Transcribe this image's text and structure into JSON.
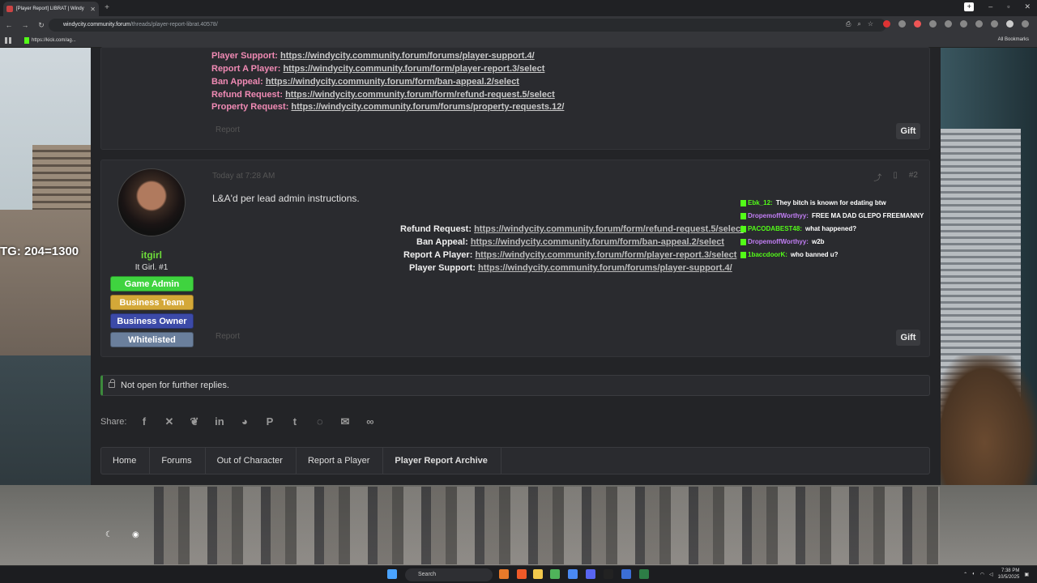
{
  "browser": {
    "tab_title": "[Player Report] LIBRAT | Windy",
    "url_domain": "windycity.community.forum",
    "url_path": "/threads/player-report-librat.40578/",
    "bookmark_kick": "https://kick.com/ag...",
    "all_bookmarks": "All Bookmarks"
  },
  "post1": {
    "links": [
      {
        "label": "Player Support:",
        "url": "https://windycity.community.forum/forums/player-support.4/"
      },
      {
        "label": "Report A Player:",
        "url": "https://windycity.community.forum/form/player-report.3/select"
      },
      {
        "label": "Ban Appeal:",
        "url": "https://windycity.community.forum/form/ban-appeal.2/select"
      },
      {
        "label": "Refund Request:",
        "url": "https://windycity.community.forum/form/refund-request.5/select"
      },
      {
        "label": "Property Request:",
        "url": "https://windycity.community.forum/forums/property-requests.12/"
      }
    ],
    "report": "Report",
    "gift": "Gift"
  },
  "post2": {
    "username": "itgirl",
    "user_title": "It Girl. #1",
    "banners": [
      "Game Admin",
      "Business Team",
      "Business Owner",
      "Whitelisted"
    ],
    "time": "Today at 7:28 AM",
    "post_number": "#2",
    "message": "L&A'd per lead admin instructions.",
    "links": [
      {
        "label": "Refund Request:",
        "url": "https://windycity.community.forum/form/refund-request.5/select"
      },
      {
        "label": "Ban Appeal:",
        "url": "https://windycity.community.forum/form/ban-appeal.2/select"
      },
      {
        "label": "Report A Player:",
        "url": "https://windycity.community.forum/form/player-report.3/select"
      },
      {
        "label": "Player Support:",
        "url": "https://windycity.community.forum/forums/player-support.4/"
      }
    ],
    "report": "Report",
    "gift": "Gift"
  },
  "chat": [
    {
      "user": "Ebk_12:",
      "color": "#53fc18",
      "msg": "They bitch is known for edating btw"
    },
    {
      "user": "DropemoffWorthyy:",
      "color": "#c27ef5",
      "msg": "FREE MA DAD GLEPO FREEMANNY"
    },
    {
      "user": "PACODABEST48:",
      "color": "#53fc18",
      "msg": "what happened?"
    },
    {
      "user": "DropemoffWorthyy:",
      "color": "#c27ef5",
      "msg": "w2b"
    },
    {
      "user": "1baccdoorK:",
      "color": "#53fc18",
      "msg": "who banned u?"
    }
  ],
  "overlay_counter": "TG: 204=1300",
  "locked_text": "Not open for further replies.",
  "share_label": "Share:",
  "share_icons": [
    "facebook-icon",
    "x-icon",
    "bluesky-icon",
    "linkedin-icon",
    "reddit-icon",
    "pinterest-icon",
    "tumblr-icon",
    "whatsapp-icon",
    "email-icon",
    "link-icon"
  ],
  "breadcrumbs": [
    "Home",
    "Forums",
    "Out of Character",
    "Report a Player",
    "Player Report Archive"
  ],
  "taskbar": {
    "search": "Search",
    "time": "7:38 PM",
    "date": "10/5/2025"
  }
}
